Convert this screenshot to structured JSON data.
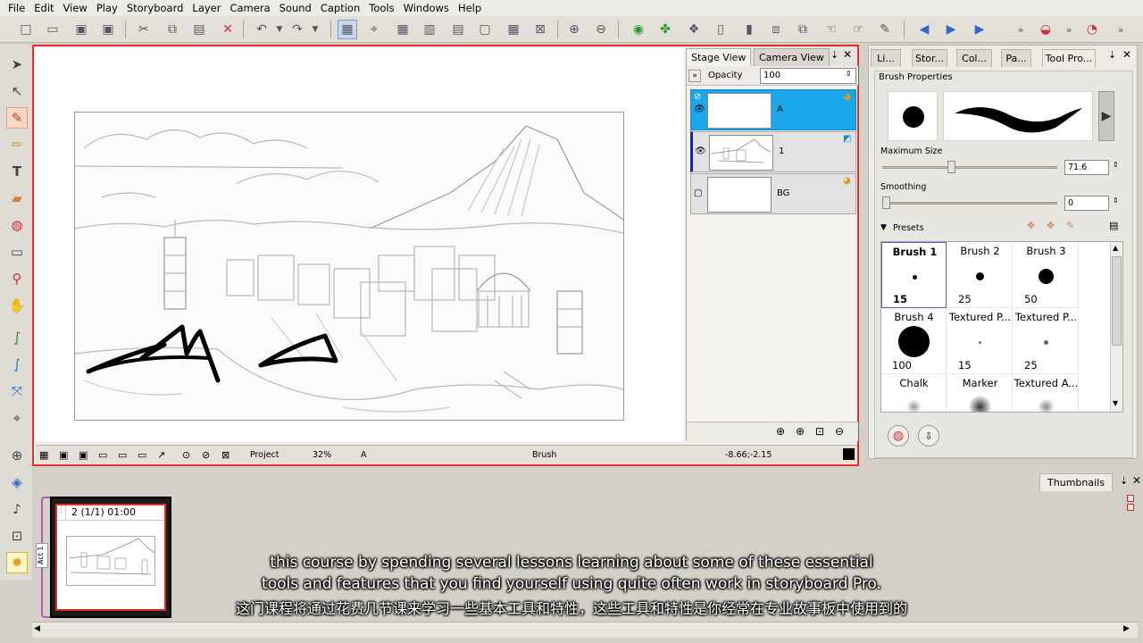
{
  "menu": [
    "File",
    "Edit",
    "View",
    "Play",
    "Storyboard",
    "Layer",
    "Camera",
    "Sound",
    "Caption",
    "Tools",
    "Windows",
    "Help"
  ],
  "stage": {
    "tabs": [
      "Stage View",
      "Camera View"
    ],
    "opacity_label": "Opacity",
    "opacity_value": "100",
    "layers": [
      {
        "name": "A",
        "selected": true
      },
      {
        "name": "1",
        "selected": false
      },
      {
        "name": "BG",
        "selected": false
      }
    ],
    "status": {
      "view": "Project",
      "zoom": "32%",
      "layer": "A",
      "tool": "Brush",
      "coords": "-8.66;-2.15"
    }
  },
  "right_panel": {
    "tabs": [
      "Li...",
      "Stor...",
      "Col...",
      "Pa...",
      "Tool Pro..."
    ],
    "section_title": "Brush Properties",
    "max_size_label": "Maximum Size",
    "max_size_value": "71.6",
    "max_size_fraction": 0.39,
    "smoothing_label": "Smoothing",
    "smoothing_value": "0",
    "smoothing_fraction": 0.0,
    "presets_label": "Presets",
    "presets": [
      {
        "name": "Brush 1",
        "size": "15"
      },
      {
        "name": "Brush 2",
        "size": "25"
      },
      {
        "name": "Brush 3",
        "size": "50"
      },
      {
        "name": "Brush 4",
        "size": "100"
      },
      {
        "name": "Textured P...",
        "size": "15"
      },
      {
        "name": "Textured P...",
        "size": "25"
      },
      {
        "name": "Chalk",
        "size": ""
      },
      {
        "name": "Marker",
        "size": ""
      },
      {
        "name": "Textured A...",
        "size": ""
      }
    ]
  },
  "thumbnails": {
    "tab": "Thumbnails",
    "panel_label": "2 (1/1) 01:00",
    "act_label": "Act 1"
  },
  "subtitles": {
    "line1": "this course by spending several lessons learning about some of these essential",
    "line2": "tools and features that you find yourself using quite often work in storyboard Pro.",
    "line3": "这门课程将通过花费几节课来学习一些基本工具和特性，这些工具和特性是你经常在专业故事板中使用到的"
  },
  "colors": {
    "accent": "#e0302a",
    "selected_layer": "#1aa6e8",
    "selected_bar": "#1a1ae8"
  }
}
